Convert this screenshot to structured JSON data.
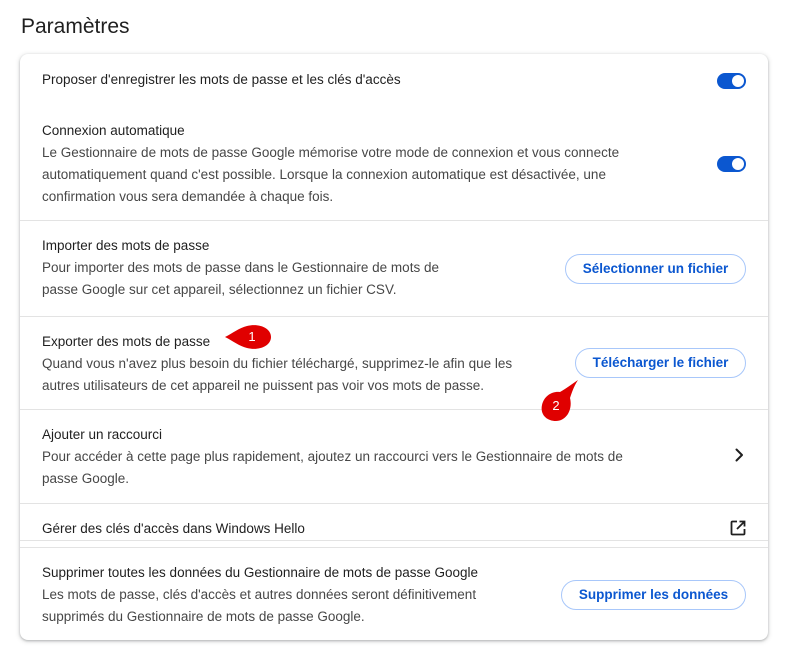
{
  "page_title": "Paramètres",
  "settings": {
    "offer_save": {
      "title": "Proposer d'enregistrer les mots de passe et les clés d'accès",
      "toggle_on": true
    },
    "auto_signin": {
      "title": "Connexion automatique",
      "desc_line1": "Le Gestionnaire de mots de passe Google mémorise votre mode de connexion et vous connecte",
      "desc_line2": "automatiquement quand c'est possible. Lorsque la connexion automatique est désactivée, une",
      "desc_line3": "confirmation vous sera demandée à chaque fois.",
      "toggle_on": true
    },
    "import": {
      "title": "Importer des mots de passe",
      "desc_line1": "Pour importer des mots de passe dans le Gestionnaire de mots de",
      "desc_line2": "passe Google sur cet appareil, sélectionnez un fichier CSV.",
      "button_label": "Sélectionner un fichier"
    },
    "export": {
      "title": "Exporter des mots de passe",
      "desc_line1": "Quand vous n'avez plus besoin du fichier téléchargé, supprimez-le afin que les",
      "desc_line2": "autres utilisateurs de cet appareil ne puissent pas voir vos mots de passe.",
      "button_label": "Télécharger le fichier"
    },
    "shortcut": {
      "title": "Ajouter un raccourci",
      "desc_line1": "Pour accéder à cette page plus rapidement, ajoutez un raccourci vers le Gestionnaire de mots de",
      "desc_line2": "passe Google.",
      "icon": "chevron-right-icon"
    },
    "windows_hello": {
      "title": "Gérer des clés d'accès dans Windows Hello",
      "icon": "open-in-new-icon"
    },
    "delete_data": {
      "title": "Supprimer toutes les données du Gestionnaire de mots de passe Google",
      "desc_line1": "Les mots de passe, clés d'accès et autres données seront définitivement",
      "desc_line2": "supprimés du Gestionnaire de mots de passe Google.",
      "button_label": "Supprimer les données"
    }
  },
  "annotations": [
    {
      "number": "1"
    },
    {
      "number": "2"
    }
  ],
  "colors": {
    "accent": "#0b57d0",
    "button_border": "#a8c7fa",
    "annotation_red": "#e00000",
    "divider": "#e3e3e3"
  }
}
